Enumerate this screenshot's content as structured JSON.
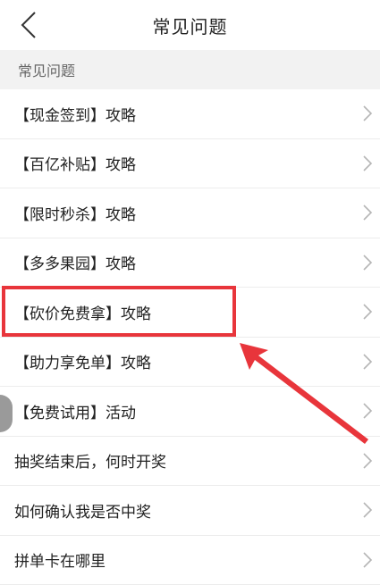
{
  "header": {
    "title": "常见问题"
  },
  "section": {
    "title": "常见问题"
  },
  "items": [
    {
      "label": "【现金签到】攻略"
    },
    {
      "label": "【百亿补贴】攻略"
    },
    {
      "label": "【限时秒杀】攻略"
    },
    {
      "label": "【多多果园】攻略"
    },
    {
      "label": "【砍价免费拿】攻略"
    },
    {
      "label": "【助力享免单】攻略"
    },
    {
      "label": "【免费试用】活动"
    },
    {
      "label": "抽奖结束后，何时开奖"
    },
    {
      "label": "如何确认我是否中奖"
    },
    {
      "label": "拼单卡在哪里"
    }
  ],
  "colors": {
    "highlight": "#e8353b",
    "section_bg": "#f2f2f2",
    "chevron": "#b5b5b5"
  },
  "icons": {
    "back": "chevron-left-icon",
    "row_arrow": "chevron-right-icon"
  }
}
